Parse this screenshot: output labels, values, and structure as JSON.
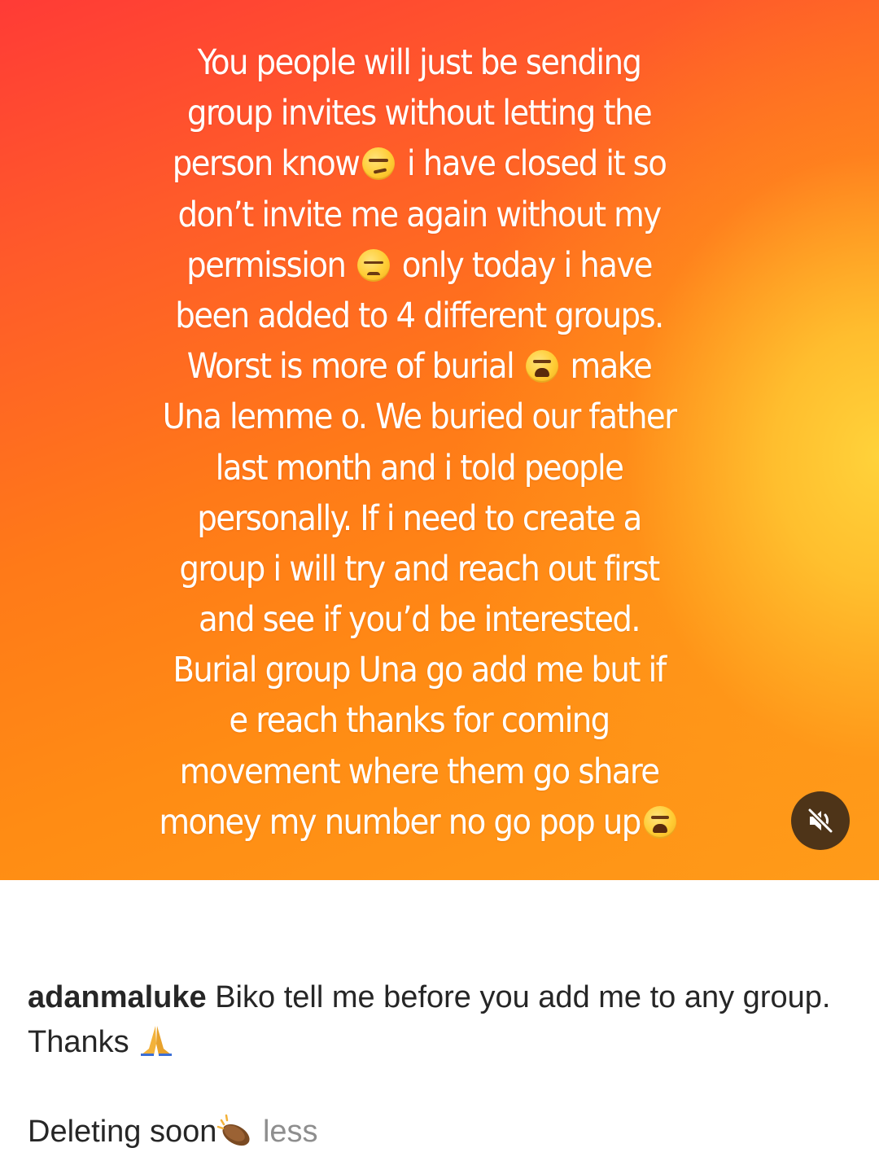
{
  "story": {
    "lines": [
      [
        "You people will just be sending"
      ],
      [
        "group invites without letting the"
      ],
      [
        "person know",
        "smirk",
        " i have closed it so"
      ],
      [
        "don’t invite me again without my"
      ],
      [
        "permission ",
        "unamused",
        " only today i have"
      ],
      [
        "been added to 4 different groups."
      ],
      [
        "Worst is more of burial ",
        "weary",
        " make"
      ],
      [
        "Una lemme o. We buried our father"
      ],
      [
        "last month and i told people"
      ],
      [
        "personally. If i need to create a"
      ],
      [
        "group i will try and reach out first"
      ],
      [
        "and see if you’d be interested."
      ],
      [
        "Burial group Una go add me but if"
      ],
      [
        "e reach thanks for coming"
      ],
      [
        "movement where them go share"
      ],
      [
        "money my number no go pop up",
        "weary"
      ]
    ],
    "mute_icon": "speaker-muted-icon",
    "colors": {
      "gradient_top_left": "#ff3b36",
      "gradient_mid": "#ff7a18",
      "gradient_glow_right": "#ffd23a",
      "mute_button_bg": "#4e3418"
    }
  },
  "caption": {
    "username": "adanmaluke",
    "text_part1": " Biko tell me before you add me to any group. Thanks ",
    "pray_icon": "folded-hands-icon",
    "text_part2": "Deleting soon",
    "clap_icon": "clapping-hands-icon",
    "more_label": " less"
  }
}
